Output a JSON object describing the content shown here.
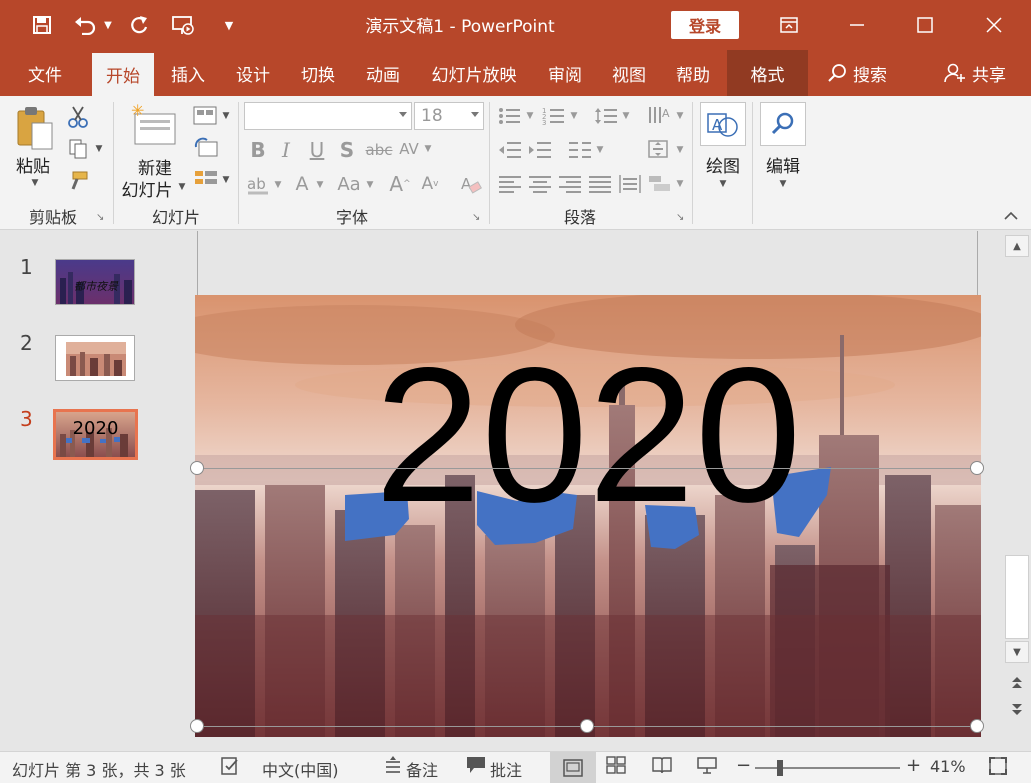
{
  "window": {
    "title": "演示文稿1  -  PowerPoint",
    "login_label": "登录"
  },
  "quick_access": {
    "save_icon": "save-icon",
    "undo_icon": "undo-icon",
    "redo_icon": "redo-icon",
    "present_icon": "present-from-start-icon",
    "customize_icon": "customize-toolbar-icon"
  },
  "tabs": [
    {
      "label": "文件"
    },
    {
      "label": "开始"
    },
    {
      "label": "插入"
    },
    {
      "label": "设计"
    },
    {
      "label": "切换"
    },
    {
      "label": "动画"
    },
    {
      "label": "幻灯片放映"
    },
    {
      "label": "审阅"
    },
    {
      "label": "视图"
    },
    {
      "label": "帮助"
    },
    {
      "label": "格式"
    }
  ],
  "search_label": "搜索",
  "share_label": "共享",
  "ribbon": {
    "clipboard": {
      "label": "剪贴板",
      "paste_label": "粘贴"
    },
    "slides": {
      "label": "幻灯片",
      "new_slide_line1": "新建",
      "new_slide_line2": "幻灯片"
    },
    "font": {
      "label": "字体",
      "font_name": "",
      "font_size": "18"
    },
    "paragraph": {
      "label": "段落"
    },
    "drawing": {
      "label": "绘图"
    },
    "editing": {
      "label": "编辑"
    }
  },
  "thumbnails": [
    {
      "number": "1",
      "caption": "都市夜景"
    },
    {
      "number": "2",
      "caption": ""
    },
    {
      "number": "3",
      "caption": "2020"
    }
  ],
  "slide": {
    "text": "2020"
  },
  "status": {
    "slide_info": "幻灯片 第 3 张，共 3 张",
    "language": "中文(中国)",
    "notes_label": "备注",
    "comments_label": "批注",
    "zoom_minus": "−",
    "zoom_plus": "+",
    "zoom_percent": "41%"
  },
  "colors": {
    "accent": "#b7472a",
    "paint_blue": "#4472c4"
  }
}
